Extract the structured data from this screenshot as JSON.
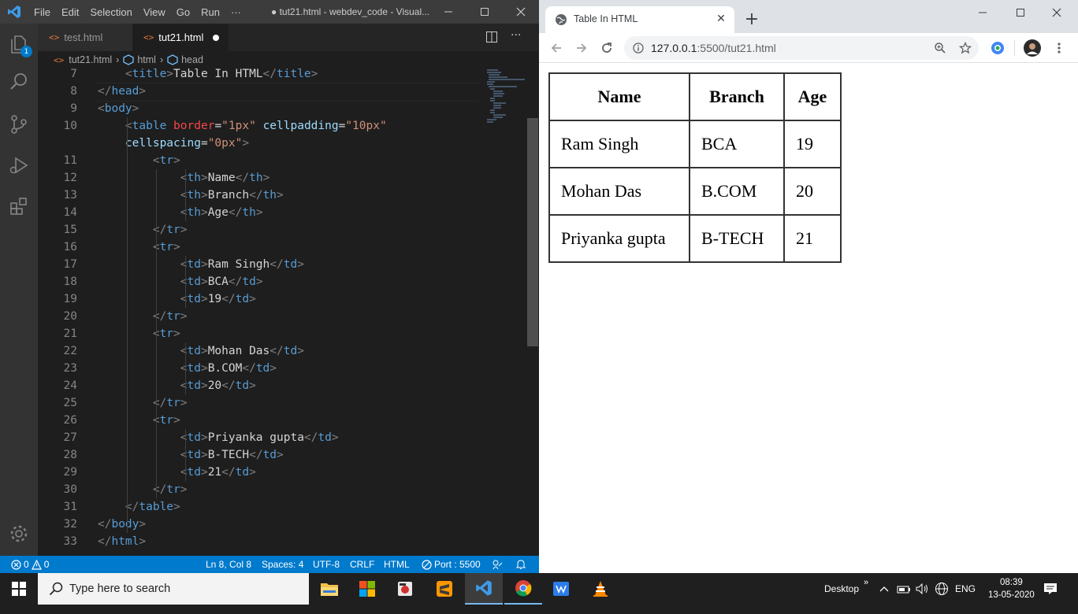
{
  "vscode": {
    "menu": [
      "File",
      "Edit",
      "Selection",
      "View",
      "Go",
      "Run",
      "···"
    ],
    "window_title": "● tut21.html - webdev_code - Visual...",
    "explorer_badge": "1",
    "tabs": [
      {
        "label": "test.html"
      },
      {
        "label": "tut21.html"
      }
    ],
    "breadcrumb": [
      "tut21.html",
      "html",
      "head"
    ],
    "lines": [
      {
        "n": "7",
        "t": [
          [
            "    ",
            "txt"
          ],
          [
            "<",
            "pun"
          ],
          [
            "title",
            "tag"
          ],
          [
            ">",
            "pun"
          ],
          [
            "Table In HTML",
            "txt"
          ],
          [
            "</",
            "pun"
          ],
          [
            "title",
            "tag"
          ],
          [
            ">",
            "pun"
          ]
        ]
      },
      {
        "n": "8",
        "t": [
          [
            "</",
            "pun"
          ],
          [
            "head",
            "tag"
          ],
          [
            ">",
            "pun"
          ]
        ]
      },
      {
        "n": "9",
        "t": [
          [
            "<",
            "pun"
          ],
          [
            "body",
            "tag"
          ],
          [
            ">",
            "pun"
          ]
        ]
      },
      {
        "n": "10",
        "t": [
          [
            "    ",
            "txt"
          ],
          [
            "<",
            "pun"
          ],
          [
            "table",
            "tag"
          ],
          [
            " ",
            "txt"
          ],
          [
            "border",
            "brd"
          ],
          [
            "=",
            "txt"
          ],
          [
            "\"1px\"",
            "str"
          ],
          [
            " ",
            "txt"
          ],
          [
            "cellpadding",
            "att"
          ],
          [
            "=",
            "txt"
          ],
          [
            "\"10px\"",
            "str"
          ]
        ]
      },
      {
        "n": "",
        "t": [
          [
            "    ",
            "txt"
          ],
          [
            "cellspacing",
            "att"
          ],
          [
            "=",
            "txt"
          ],
          [
            "\"0px\"",
            "str"
          ],
          [
            ">",
            "pun"
          ]
        ]
      },
      {
        "n": "11",
        "t": [
          [
            "        ",
            "txt"
          ],
          [
            "<",
            "pun"
          ],
          [
            "tr",
            "tag"
          ],
          [
            ">",
            "pun"
          ]
        ]
      },
      {
        "n": "12",
        "t": [
          [
            "            ",
            "txt"
          ],
          [
            "<",
            "pun"
          ],
          [
            "th",
            "tag"
          ],
          [
            ">",
            "pun"
          ],
          [
            "Name",
            "txt"
          ],
          [
            "</",
            "pun"
          ],
          [
            "th",
            "tag"
          ],
          [
            ">",
            "pun"
          ]
        ]
      },
      {
        "n": "13",
        "t": [
          [
            "            ",
            "txt"
          ],
          [
            "<",
            "pun"
          ],
          [
            "th",
            "tag"
          ],
          [
            ">",
            "pun"
          ],
          [
            "Branch",
            "txt"
          ],
          [
            "</",
            "pun"
          ],
          [
            "th",
            "tag"
          ],
          [
            ">",
            "pun"
          ]
        ]
      },
      {
        "n": "14",
        "t": [
          [
            "            ",
            "txt"
          ],
          [
            "<",
            "pun"
          ],
          [
            "th",
            "tag"
          ],
          [
            ">",
            "pun"
          ],
          [
            "Age",
            "txt"
          ],
          [
            "</",
            "pun"
          ],
          [
            "th",
            "tag"
          ],
          [
            ">",
            "pun"
          ]
        ]
      },
      {
        "n": "15",
        "t": [
          [
            "        ",
            "txt"
          ],
          [
            "</",
            "pun"
          ],
          [
            "tr",
            "tag"
          ],
          [
            ">",
            "pun"
          ]
        ]
      },
      {
        "n": "16",
        "t": [
          [
            "        ",
            "txt"
          ],
          [
            "<",
            "pun"
          ],
          [
            "tr",
            "tag"
          ],
          [
            ">",
            "pun"
          ]
        ]
      },
      {
        "n": "17",
        "t": [
          [
            "            ",
            "txt"
          ],
          [
            "<",
            "pun"
          ],
          [
            "td",
            "tag"
          ],
          [
            ">",
            "pun"
          ],
          [
            "Ram Singh",
            "txt"
          ],
          [
            "</",
            "pun"
          ],
          [
            "td",
            "tag"
          ],
          [
            ">",
            "pun"
          ]
        ]
      },
      {
        "n": "18",
        "t": [
          [
            "            ",
            "txt"
          ],
          [
            "<",
            "pun"
          ],
          [
            "td",
            "tag"
          ],
          [
            ">",
            "pun"
          ],
          [
            "BCA",
            "txt"
          ],
          [
            "</",
            "pun"
          ],
          [
            "td",
            "tag"
          ],
          [
            ">",
            "pun"
          ]
        ]
      },
      {
        "n": "19",
        "t": [
          [
            "            ",
            "txt"
          ],
          [
            "<",
            "pun"
          ],
          [
            "td",
            "tag"
          ],
          [
            ">",
            "pun"
          ],
          [
            "19",
            "txt"
          ],
          [
            "</",
            "pun"
          ],
          [
            "td",
            "tag"
          ],
          [
            ">",
            "pun"
          ]
        ]
      },
      {
        "n": "20",
        "t": [
          [
            "        ",
            "txt"
          ],
          [
            "</",
            "pun"
          ],
          [
            "tr",
            "tag"
          ],
          [
            ">",
            "pun"
          ]
        ]
      },
      {
        "n": "21",
        "t": [
          [
            "        ",
            "txt"
          ],
          [
            "<",
            "pun"
          ],
          [
            "tr",
            "tag"
          ],
          [
            ">",
            "pun"
          ]
        ]
      },
      {
        "n": "22",
        "t": [
          [
            "            ",
            "txt"
          ],
          [
            "<",
            "pun"
          ],
          [
            "td",
            "tag"
          ],
          [
            ">",
            "pun"
          ],
          [
            "Mohan Das",
            "txt"
          ],
          [
            "</",
            "pun"
          ],
          [
            "td",
            "tag"
          ],
          [
            ">",
            "pun"
          ]
        ]
      },
      {
        "n": "23",
        "t": [
          [
            "            ",
            "txt"
          ],
          [
            "<",
            "pun"
          ],
          [
            "td",
            "tag"
          ],
          [
            ">",
            "pun"
          ],
          [
            "B.COM",
            "txt"
          ],
          [
            "</",
            "pun"
          ],
          [
            "td",
            "tag"
          ],
          [
            ">",
            "pun"
          ]
        ]
      },
      {
        "n": "24",
        "t": [
          [
            "            ",
            "txt"
          ],
          [
            "<",
            "pun"
          ],
          [
            "td",
            "tag"
          ],
          [
            ">",
            "pun"
          ],
          [
            "20",
            "txt"
          ],
          [
            "</",
            "pun"
          ],
          [
            "td",
            "tag"
          ],
          [
            ">",
            "pun"
          ]
        ]
      },
      {
        "n": "25",
        "t": [
          [
            "        ",
            "txt"
          ],
          [
            "</",
            "pun"
          ],
          [
            "tr",
            "tag"
          ],
          [
            ">",
            "pun"
          ]
        ]
      },
      {
        "n": "26",
        "t": [
          [
            "        ",
            "txt"
          ],
          [
            "<",
            "pun"
          ],
          [
            "tr",
            "tag"
          ],
          [
            ">",
            "pun"
          ]
        ]
      },
      {
        "n": "27",
        "t": [
          [
            "            ",
            "txt"
          ],
          [
            "<",
            "pun"
          ],
          [
            "td",
            "tag"
          ],
          [
            ">",
            "pun"
          ],
          [
            "Priyanka gupta",
            "txt"
          ],
          [
            "</",
            "pun"
          ],
          [
            "td",
            "tag"
          ],
          [
            ">",
            "pun"
          ]
        ]
      },
      {
        "n": "28",
        "t": [
          [
            "            ",
            "txt"
          ],
          [
            "<",
            "pun"
          ],
          [
            "td",
            "tag"
          ],
          [
            ">",
            "pun"
          ],
          [
            "B-TECH",
            "txt"
          ],
          [
            "</",
            "pun"
          ],
          [
            "td",
            "tag"
          ],
          [
            ">",
            "pun"
          ]
        ]
      },
      {
        "n": "29",
        "t": [
          [
            "            ",
            "txt"
          ],
          [
            "<",
            "pun"
          ],
          [
            "td",
            "tag"
          ],
          [
            ">",
            "pun"
          ],
          [
            "21",
            "txt"
          ],
          [
            "</",
            "pun"
          ],
          [
            "td",
            "tag"
          ],
          [
            ">",
            "pun"
          ]
        ]
      },
      {
        "n": "30",
        "t": [
          [
            "        ",
            "txt"
          ],
          [
            "</",
            "pun"
          ],
          [
            "tr",
            "tag"
          ],
          [
            ">",
            "pun"
          ]
        ]
      },
      {
        "n": "31",
        "t": [
          [
            "    ",
            "txt"
          ],
          [
            "</",
            "pun"
          ],
          [
            "table",
            "tag"
          ],
          [
            ">",
            "pun"
          ]
        ]
      },
      {
        "n": "32",
        "t": [
          [
            "</",
            "pun"
          ],
          [
            "body",
            "tag"
          ],
          [
            ">",
            "pun"
          ]
        ]
      },
      {
        "n": "33",
        "t": [
          [
            "</",
            "pun"
          ],
          [
            "html",
            "tag"
          ],
          [
            ">",
            "pun"
          ]
        ]
      }
    ],
    "status": {
      "errors": "0",
      "warnings": "0",
      "position": "Ln 8, Col 8",
      "spaces": "Spaces: 4",
      "encoding": "UTF-8",
      "eol": "CRLF",
      "language": "HTML",
      "port": "Port : 5500"
    }
  },
  "chrome": {
    "tab_title": "Table In HTML",
    "url_host": "127.0.0.1",
    "url_path": ":5500/tut21.html",
    "table": {
      "headers": [
        "Name",
        "Branch",
        "Age"
      ],
      "rows": [
        [
          "Ram Singh",
          "BCA",
          "19"
        ],
        [
          "Mohan Das",
          "B.COM",
          "20"
        ],
        [
          "Priyanka gupta",
          "B-TECH",
          "21"
        ]
      ]
    }
  },
  "taskbar": {
    "search_placeholder": "Type here to search",
    "desktop_label": "Desktop",
    "language": "ENG",
    "time": "08:39",
    "date": "13-05-2020",
    "apps": [
      "file-explorer",
      "microsoft-store",
      "media-app",
      "sublime-text",
      "vscode",
      "chrome",
      "writer-app",
      "vlc"
    ]
  },
  "colors": {
    "vscode_bg": "#1e1e1e",
    "status_bar": "#007acc",
    "html_tag": "#569cd6",
    "attribute": "#9cdcfe",
    "string": "#ce9178"
  }
}
